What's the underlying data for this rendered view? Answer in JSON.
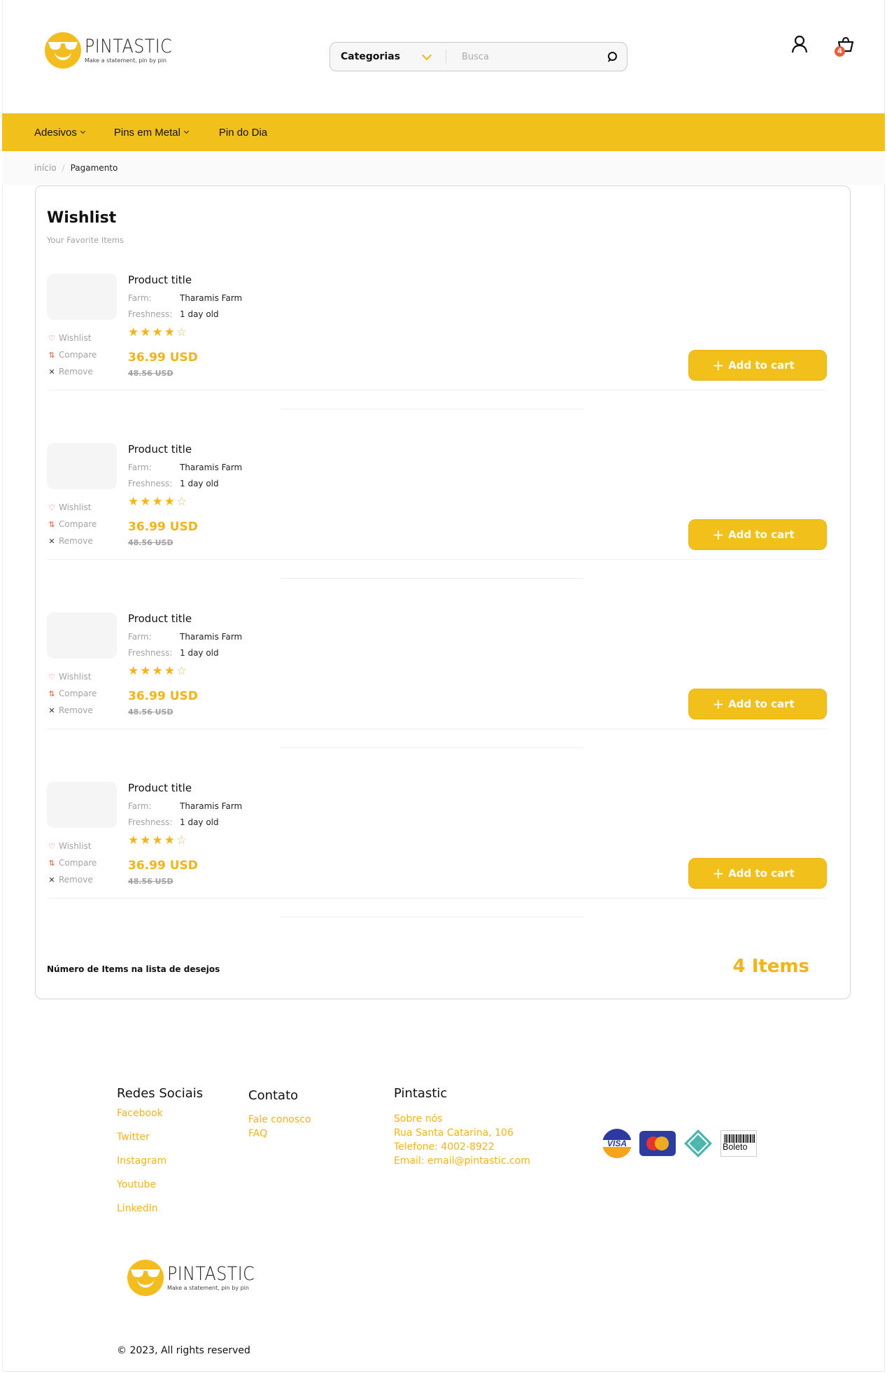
{
  "brand": {
    "name": "PINTASTIC",
    "tagline": "Make a statement, pin by pin"
  },
  "header": {
    "category_label": "Categorias",
    "search_placeholder": "Busca",
    "cart_count": "4"
  },
  "nav": {
    "items": [
      {
        "label": "Adesivos",
        "dropdown": true
      },
      {
        "label": "Pins em Metal",
        "dropdown": true
      },
      {
        "label": "Pin do Dia",
        "dropdown": false
      }
    ]
  },
  "breadcrumb": {
    "home": "início",
    "separator": "/",
    "current": "Pagamento"
  },
  "wishlist": {
    "title": "Wishlist",
    "subtitle": "Your Favorite Items",
    "items": [
      {
        "title": "Product title",
        "farm_label": "Farm:",
        "farm": "Tharamis Farm",
        "freshness_label": "Freshness:",
        "freshness": "1 day old",
        "rating": 4,
        "rating_max": 5,
        "price": "36.99 USD",
        "old_price": "48.56 USD",
        "wishlist_label": "Wishlist",
        "compare_label": "Compare",
        "remove_label": "Remove",
        "cta": "Add to cart"
      },
      {
        "title": "Product title",
        "farm_label": "Farm:",
        "farm": "Tharamis Farm",
        "freshness_label": "Freshness:",
        "freshness": "1 day old",
        "rating": 4,
        "rating_max": 5,
        "price": "36.99 USD",
        "old_price": "48.56 USD",
        "wishlist_label": "Wishlist",
        "compare_label": "Compare",
        "remove_label": "Remove",
        "cta": "Add to cart"
      },
      {
        "title": "Product title",
        "farm_label": "Farm:",
        "farm": "Tharamis Farm",
        "freshness_label": "Freshness:",
        "freshness": "1 day old",
        "rating": 4,
        "rating_max": 5,
        "price": "36.99 USD",
        "old_price": "48.56 USD",
        "wishlist_label": "Wishlist",
        "compare_label": "Compare",
        "remove_label": "Remove",
        "cta": "Add to cart"
      },
      {
        "title": "Product title",
        "farm_label": "Farm:",
        "farm": "Tharamis Farm",
        "freshness_label": "Freshness:",
        "freshness": "1 day old",
        "rating": 4,
        "rating_max": 5,
        "price": "36.99 USD",
        "old_price": "48.56 USD",
        "wishlist_label": "Wishlist",
        "compare_label": "Compare",
        "remove_label": "Remove",
        "cta": "Add to cart"
      }
    ],
    "count_label": "Número de Items na lista de desejos",
    "count_value": "4 Items"
  },
  "footer": {
    "social": {
      "heading": "Redes Sociais",
      "links": [
        "Facebook",
        "Twitter",
        "Instagram",
        "Youtube",
        "LinkedIn"
      ]
    },
    "contact": {
      "heading": "Contato",
      "links": [
        "Fale conosco",
        "FAQ"
      ]
    },
    "about": {
      "heading": "Pintastic",
      "lines": [
        "Sobre nós",
        "Rua Santa Catarina, 106",
        "Telefone: 4002-8922",
        "Email: email@pintastic.com"
      ]
    },
    "payments": {
      "visa": "VISA",
      "boleto": "Boleto"
    },
    "copyright": "© 2023, All rights reserved"
  },
  "colors": {
    "accent": "#f2c01a",
    "price": "#f2b418",
    "badge": "#e8603c"
  }
}
